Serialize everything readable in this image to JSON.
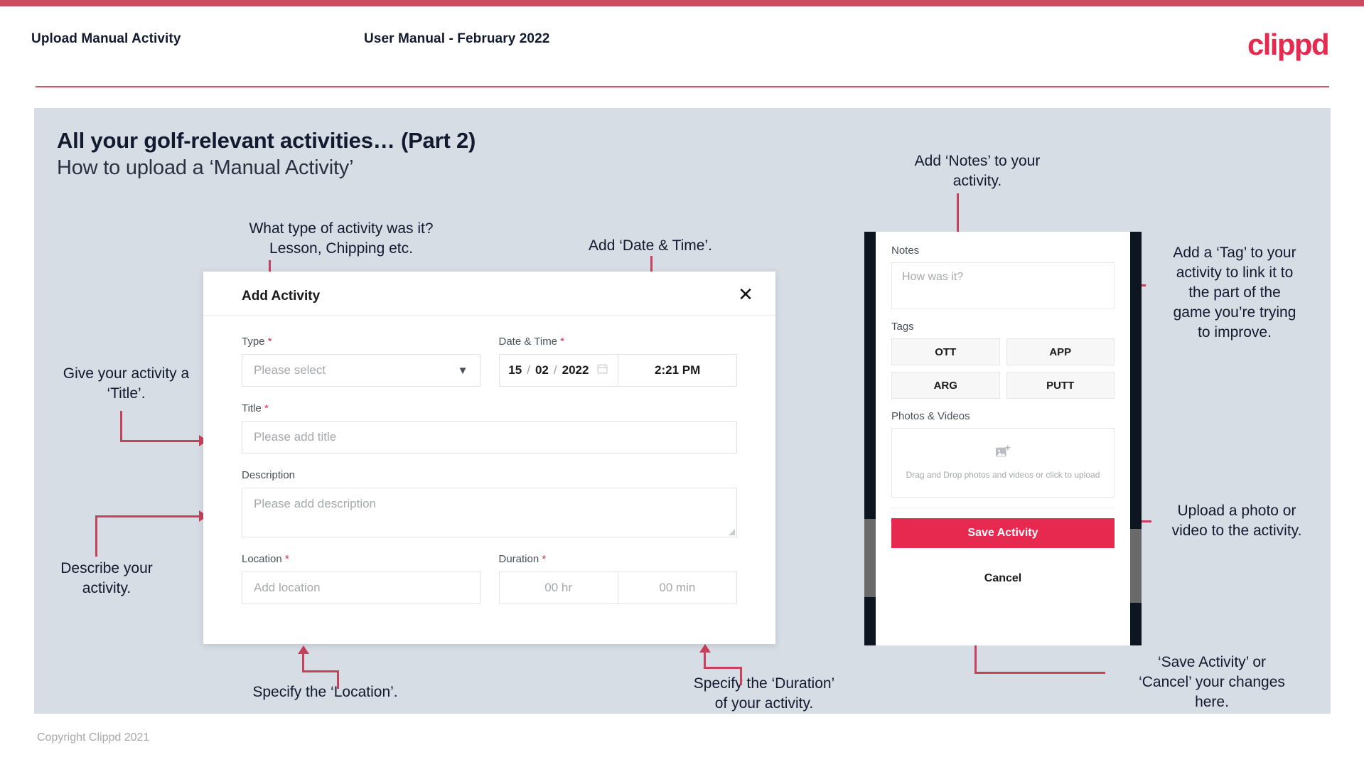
{
  "header": {
    "title": "Upload Manual Activity",
    "subtitle": "User Manual - February 2022",
    "logo": "clippd"
  },
  "slide": {
    "title": "All your golf-relevant activities… (Part 2)",
    "subtitle": "How to upload a ‘Manual Activity’"
  },
  "annotations": {
    "type": "What type of activity was it?\nLesson, Chipping etc.",
    "datetime": "Add ‘Date & Time’.",
    "title": "Give your activity a\n‘Title’.",
    "description": "Describe your\nactivity.",
    "location": "Specify the ‘Location’.",
    "duration": "Specify the ‘Duration’\nof your activity.",
    "notes": "Add ‘Notes’ to your\nactivity.",
    "tag": "Add a ‘Tag’ to your\nactivity to link it to\nthe part of the\ngame you’re trying\nto improve.",
    "upload": "Upload a photo or\nvideo to the activity.",
    "save": "‘Save Activity’ or\n‘Cancel’ your changes\nhere."
  },
  "dialog": {
    "title": "Add Activity",
    "close_icon": "close-icon",
    "fields": {
      "type_label": "Type",
      "type_placeholder": "Please select",
      "datetime_label": "Date & Time",
      "date_day": "15",
      "date_month": "02",
      "date_year": "2022",
      "date_sep": "/",
      "time_value": "2:21 PM",
      "title_label": "Title",
      "title_placeholder": "Please add title",
      "description_label": "Description",
      "description_placeholder": "Please add description",
      "location_label": "Location",
      "location_placeholder": "Add location",
      "duration_label": "Duration",
      "duration_hours": "00 hr",
      "duration_minutes": "00 min"
    },
    "required_mark": "*"
  },
  "phone": {
    "notes_label": "Notes",
    "notes_placeholder": "How was it?",
    "tags_label": "Tags",
    "tags": [
      "OTT",
      "APP",
      "ARG",
      "PUTT"
    ],
    "photos_label": "Photos & Videos",
    "drop_icon": "add-image-icon",
    "drop_text": "Drag and Drop photos and videos or click to upload",
    "save_label": "Save Activity",
    "cancel_label": "Cancel"
  },
  "footer": {
    "copyright": "Copyright Clippd 2021"
  },
  "colors": {
    "brand_pink": "#e8294f",
    "accent_line": "#c8405c",
    "slide_bg": "#d7dde5",
    "ink": "#111a2e"
  }
}
